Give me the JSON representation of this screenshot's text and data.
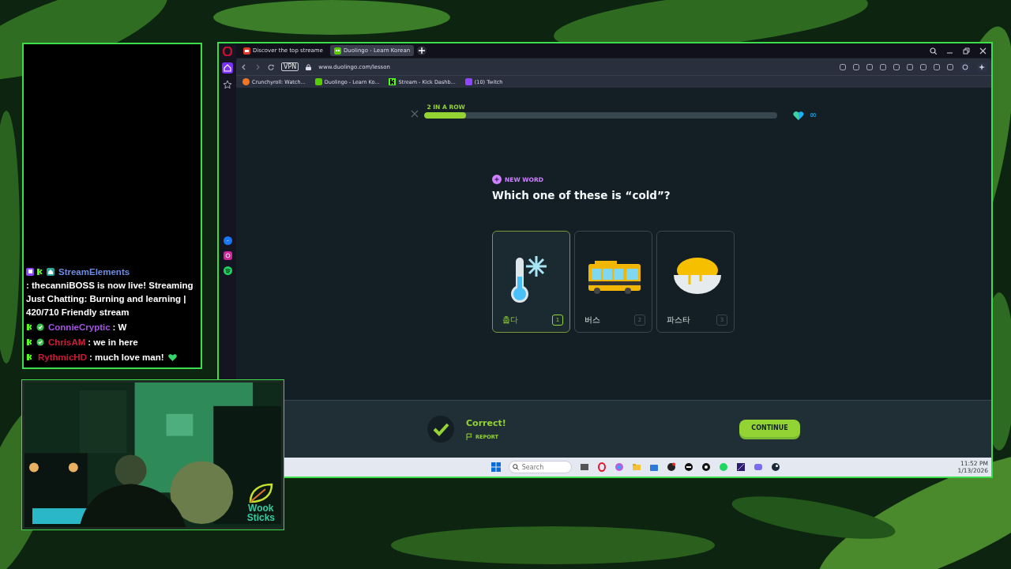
{
  "chat": {
    "messages": [
      {
        "badges": [
          {
            "kind": "twitch"
          },
          {
            "kind": "kick"
          },
          {
            "kind": "home"
          }
        ],
        "name": "StreamElements",
        "color": "#6b8de6",
        "text": ": thecanniBOSS is now live! Streaming Just Chatting: Burning and learning | 420/710 Friendly stream",
        "heart": false
      },
      {
        "badges": [
          {
            "kind": "kick"
          },
          {
            "kind": "verified"
          }
        ],
        "name": "ConnieCryptic",
        "color": "#a455e0",
        "text": ": W",
        "heart": false
      },
      {
        "badges": [
          {
            "kind": "kick"
          },
          {
            "kind": "verified"
          }
        ],
        "name": "ChrisAM",
        "color": "#c8203c",
        "text": ": we in here",
        "heart": false
      },
      {
        "badges": [
          {
            "kind": "kick"
          }
        ],
        "name": "RythmicHD",
        "color": "#c81a3a",
        "text": ": much love man!",
        "heart": true
      }
    ]
  },
  "overlay": {
    "logo_top": "Wook",
    "logo_bottom": "Sticks"
  },
  "browser": {
    "tabs": [
      {
        "title": "Discover the top streame",
        "selected": false
      },
      {
        "title": "Duolingo - Learn Korean",
        "selected": true
      }
    ],
    "vpn": "VPN",
    "url": "www.duolingo.com/lesson",
    "bookmarks": [
      {
        "kind": "crunchyroll",
        "title": "Crunchyroll: Watch..."
      },
      {
        "kind": "duolingo",
        "title": "Duolingo - Learn Ko..."
      },
      {
        "kind": "kick",
        "title": "Stream - Kick Dashb..."
      },
      {
        "kind": "twitch",
        "title": "(10) Twitch"
      }
    ],
    "lesson": {
      "streak": "2 IN A ROW",
      "progress": {
        "level": 0.12
      },
      "hearts": "∞",
      "tag": "NEW WORD",
      "question": "Which one of these is “cold”?",
      "options": [
        {
          "kind": "thermometer",
          "word": "춥다",
          "key": "1",
          "selected": true
        },
        {
          "kind": "bus",
          "word": "버스",
          "key": "2",
          "selected": false
        },
        {
          "kind": "pasta",
          "word": "파스타",
          "key": "3",
          "selected": false
        }
      ],
      "feedback": {
        "title": "Correct!",
        "report": "REPORT",
        "button": "CONTINUE"
      }
    }
  },
  "taskbar": {
    "search": {
      "placeholder": "Search"
    },
    "time": "11:52 PM",
    "date": "1/13/2026"
  }
}
